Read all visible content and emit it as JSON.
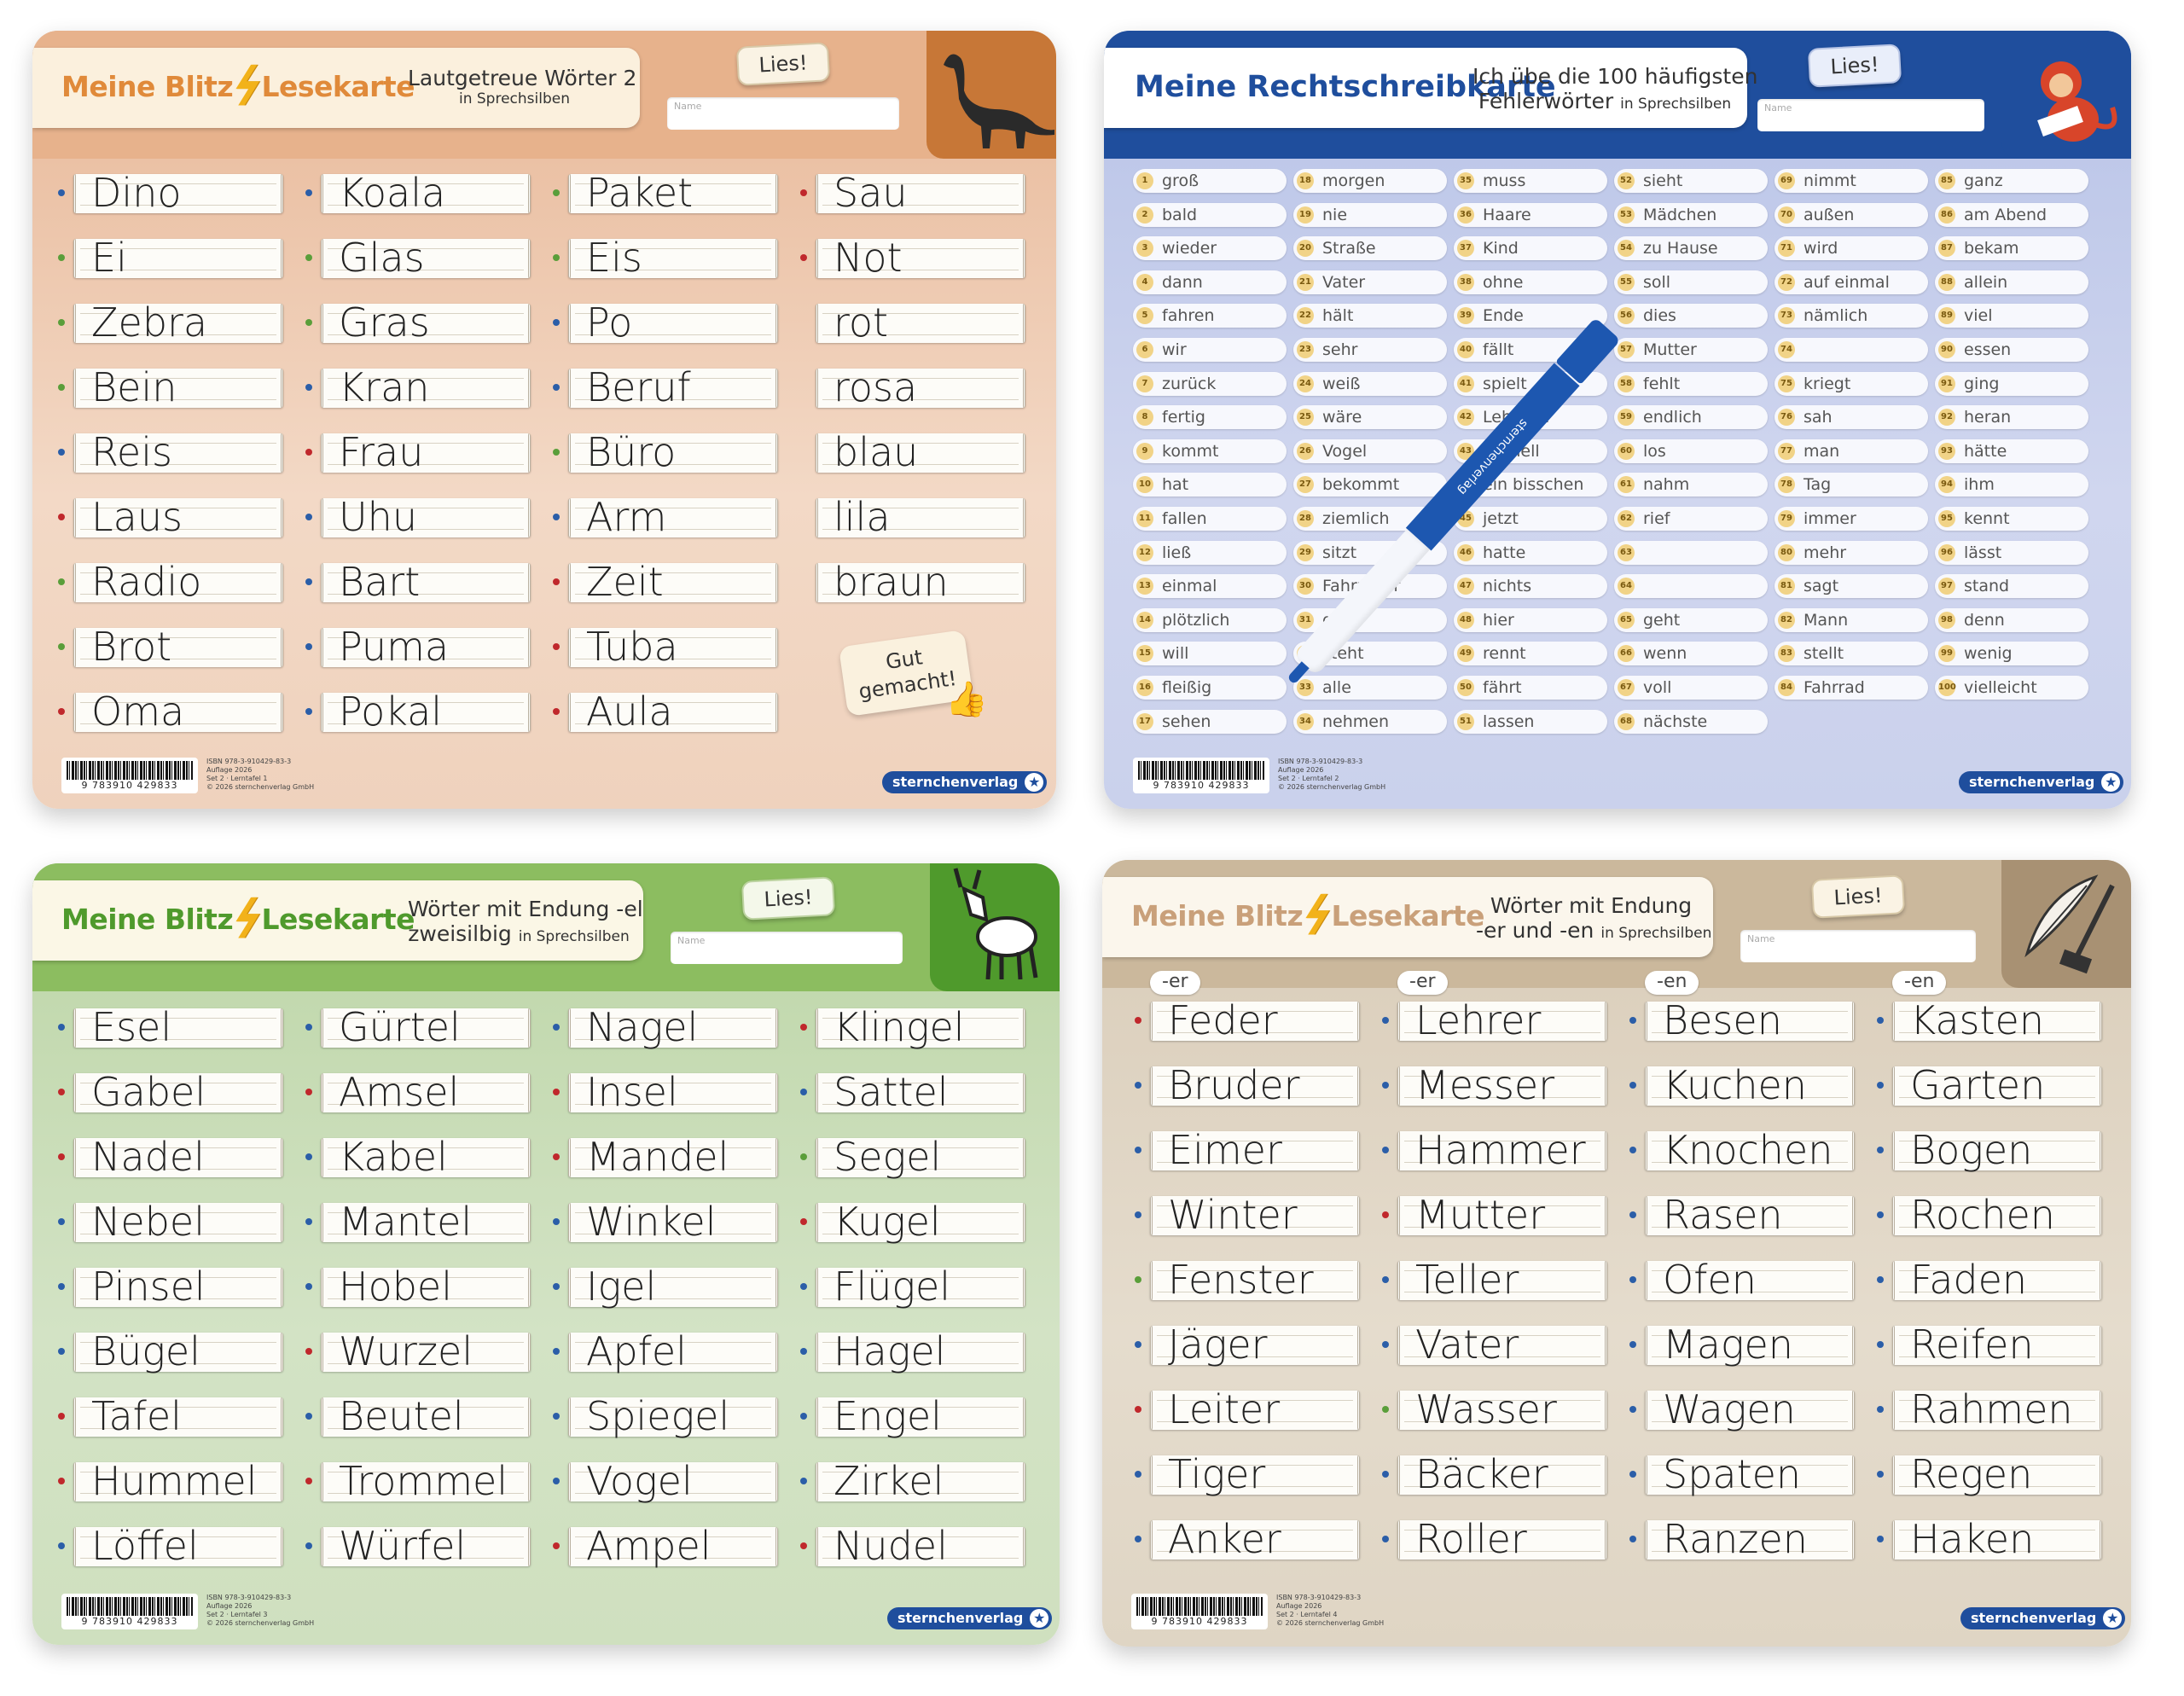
{
  "colors": {
    "orange_bg": "#ecc5ab",
    "orange_head": "#e2a77e",
    "blue_bg": "#c4cce9",
    "blue_head": "#1f4e9d",
    "green_bg": "#c9dcb7",
    "green_head": "#7fb25a",
    "beige_bg": "#ddd2c0",
    "beige_head": "#c7b499",
    "dot_red": "#c0282c",
    "dot_blue": "#2b5ea8",
    "dot_green": "#5a9e3a"
  },
  "card1": {
    "brand_meine": "Meine Blitz",
    "brand_rest": "Lesekarte",
    "subtitle_line1": "Lautgetreue Wörter 2",
    "subtitle_small": "in Sprechsilben",
    "lies": "Lies!",
    "name_label": "Name",
    "icon": "dinosaur-icon",
    "columns": [
      [
        "Dino",
        "Ei",
        "Zebra",
        "Bein",
        "Reis",
        "Laus",
        "Radio",
        "Brot",
        "Oma"
      ],
      [
        "Koala",
        "Glas",
        "Gras",
        "Kran",
        "Frau",
        "Uhu",
        "Bart",
        "Puma",
        "Pokal"
      ],
      [
        "Paket",
        "Eis",
        "Po",
        "Beruf",
        "Büro",
        "Arm",
        "Zeit",
        "Tuba",
        "Aula"
      ],
      [
        "Sau",
        "Not",
        "rot",
        "rosa",
        "blau",
        "lila",
        "braun"
      ]
    ],
    "dots": [
      [
        "blue",
        "green",
        "green",
        "green",
        "blue",
        "red",
        "green",
        "green",
        "red"
      ],
      [
        "blue",
        "green",
        "green",
        "blue",
        "red",
        "blue",
        "blue",
        "blue",
        "blue"
      ],
      [
        "green",
        "green",
        "blue",
        "blue",
        "green",
        "blue",
        "red",
        "red",
        "red"
      ],
      [
        "red",
        "red",
        "none",
        "none",
        "none",
        "none",
        "none"
      ]
    ],
    "gut": "Gut gemacht!",
    "isbn_lines": [
      "ISBN 978-3-910429-83-3",
      "Auflage 2026",
      "Set 2 · Lerntafel 1",
      "© 2026 sternchenverlag GmbH"
    ],
    "barcode_number": "9 783910 429833",
    "logo": "sternchenverlag"
  },
  "card2": {
    "title": "Meine Rechtschreibkarte",
    "subtitle_line1": "Ich übe die 100 häufigsten",
    "subtitle_line2": "Fehlerwörter",
    "subtitle_small": "in Sprechsilben",
    "lies": "Lies!",
    "name_label": "Name",
    "icon": "monkey-icon",
    "columns": [
      [
        "groß",
        "bald",
        "wieder",
        "dann",
        "fahren",
        "wir",
        "zurück",
        "fertig",
        "kommt",
        "hat",
        "fallen",
        "ließ",
        "einmal",
        "plötzlich",
        "will",
        "fleißig",
        "sehen"
      ],
      [
        "morgen",
        "nie",
        "Straße",
        "Vater",
        "hält",
        "sehr",
        "weiß",
        "wäre",
        "Vogel",
        "bekommt",
        "ziemlich",
        "sitzt",
        "Fahrräder",
        "gibt",
        "steht",
        "alle",
        "nehmen"
      ],
      [
        "muss",
        "Haare",
        "Kind",
        "ohne",
        "Ende",
        "fällt",
        "spielt",
        "Lehrerin",
        "schnell",
        "ein bisschen",
        "jetzt",
        "hatte",
        "nichts",
        "hier",
        "rennt",
        "fährt",
        "lassen"
      ],
      [
        "sieht",
        "Mädchen",
        "zu Hause",
        "soll",
        "dies",
        "Mutter",
        "fehlt",
        "endlich",
        "los",
        "nahm",
        "rief",
        "",
        "",
        "geht",
        "wenn",
        "voll",
        "nächste"
      ],
      [
        "nimmt",
        "außen",
        "wird",
        "auf einmal",
        "nämlich",
        "",
        "kriegt",
        "sah",
        "man",
        "Tag",
        "immer",
        "mehr",
        "sagt",
        "Mann",
        "stellt",
        "Fahrrad"
      ],
      [
        "ganz",
        "am Abend",
        "bekam",
        "allein",
        "viel",
        "essen",
        "ging",
        "heran",
        "hätte",
        "ihm",
        "kennt",
        "lässt",
        "stand",
        "denn",
        "wenig",
        "vielleicht"
      ]
    ],
    "numbers": [
      [
        "1",
        "2",
        "3",
        "4",
        "5",
        "6",
        "7",
        "8",
        "9",
        "10",
        "11",
        "12",
        "13",
        "14",
        "15",
        "16",
        "17"
      ],
      [
        "18",
        "19",
        "20",
        "21",
        "22",
        "23",
        "24",
        "25",
        "26",
        "27",
        "28",
        "29",
        "30",
        "31",
        "32",
        "33",
        "34"
      ],
      [
        "35",
        "36",
        "37",
        "38",
        "39",
        "40",
        "41",
        "42",
        "43",
        "44",
        "45",
        "46",
        "47",
        "48",
        "49",
        "50",
        "51"
      ],
      [
        "52",
        "53",
        "54",
        "55",
        "56",
        "57",
        "58",
        "59",
        "60",
        "61",
        "62",
        "63",
        "64",
        "65",
        "66",
        "67",
        "68"
      ],
      [
        "69",
        "70",
        "71",
        "72",
        "73",
        "74",
        "75",
        "76",
        "77",
        "78",
        "79",
        "80",
        "81",
        "82",
        "83",
        "84"
      ],
      [
        "85",
        "86",
        "87",
        "88",
        "89",
        "90",
        "91",
        "92",
        "93",
        "94",
        "95",
        "96",
        "97",
        "98",
        "99",
        "100"
      ]
    ],
    "pen_label": "sternchenverlag",
    "isbn_lines": [
      "ISBN 978-3-910429-83-3",
      "Auflage 2026",
      "Set 2 · Lerntafel 2",
      "© 2026 sternchenverlag GmbH"
    ],
    "barcode_number": "9 783910 429833",
    "logo": "sternchenverlag"
  },
  "card3": {
    "brand_meine": "Meine Blitz",
    "brand_rest": "Lesekarte",
    "subtitle_line1": "Wörter mit Endung -el",
    "subtitle_line2": "zweisilbig",
    "subtitle_small": "in Sprechsilben",
    "lies": "Lies!",
    "name_label": "Name",
    "icon": "donkey-icon",
    "columns": [
      [
        "Esel",
        "Gabel",
        "Nadel",
        "Nebel",
        "Pinsel",
        "Bügel",
        "Tafel",
        "Hummel",
        "Löffel"
      ],
      [
        "Gürtel",
        "Amsel",
        "Kabel",
        "Mantel",
        "Hobel",
        "Wurzel",
        "Beutel",
        "Trommel",
        "Würfel"
      ],
      [
        "Nagel",
        "Insel",
        "Mandel",
        "Winkel",
        "Igel",
        "Apfel",
        "Spiegel",
        "Vogel",
        "Ampel"
      ],
      [
        "Klingel",
        "Sattel",
        "Segel",
        "Kugel",
        "Flügel",
        "Hagel",
        "Engel",
        "Zirkel",
        "Nudel"
      ]
    ],
    "dots": [
      [
        "blue",
        "red",
        "red",
        "blue",
        "blue",
        "blue",
        "red",
        "red",
        "blue"
      ],
      [
        "blue",
        "red",
        "blue",
        "blue",
        "blue",
        "red",
        "blue",
        "red",
        "blue"
      ],
      [
        "blue",
        "red",
        "red",
        "blue",
        "blue",
        "blue",
        "blue",
        "blue",
        "red"
      ],
      [
        "red",
        "blue",
        "green",
        "red",
        "blue",
        "blue",
        "blue",
        "blue",
        "red"
      ]
    ],
    "isbn_lines": [
      "ISBN 978-3-910429-83-3",
      "Auflage 2026",
      "Set 2 · Lerntafel 3",
      "© 2026 sternchenverlag GmbH"
    ],
    "barcode_number": "9 783910 429833",
    "logo": "sternchenverlag"
  },
  "card4": {
    "brand_meine": "Meine Blitz",
    "brand_rest": "Lesekarte",
    "subtitle_line1": "Wörter mit Endung",
    "subtitle_line2": "-er und -en",
    "subtitle_small": "in Sprechsilben",
    "lies": "Lies!",
    "name_label": "Name",
    "icon": "feather-hammer-icon",
    "suffixes": [
      "-er",
      "-er",
      "-en",
      "-en"
    ],
    "columns": [
      [
        "Feder",
        "Bruder",
        "Eimer",
        "Winter",
        "Fenster",
        "Jäger",
        "Leiter",
        "Tiger",
        "Anker"
      ],
      [
        "Lehrer",
        "Messer",
        "Hammer",
        "Mutter",
        "Teller",
        "Vater",
        "Wasser",
        "Bäcker",
        "Roller"
      ],
      [
        "Besen",
        "Kuchen",
        "Knochen",
        "Rasen",
        "Ofen",
        "Magen",
        "Wagen",
        "Spaten",
        "Ranzen"
      ],
      [
        "Kasten",
        "Garten",
        "Bogen",
        "Rochen",
        "Faden",
        "Reifen",
        "Rahmen",
        "Regen",
        "Haken"
      ]
    ],
    "dots": [
      [
        "red",
        "blue",
        "blue",
        "blue",
        "green",
        "blue",
        "red",
        "blue",
        "blue"
      ],
      [
        "blue",
        "blue",
        "blue",
        "red",
        "blue",
        "blue",
        "green",
        "blue",
        "blue"
      ],
      [
        "blue",
        "blue",
        "blue",
        "blue",
        "blue",
        "blue",
        "blue",
        "blue",
        "blue"
      ],
      [
        "blue",
        "blue",
        "blue",
        "blue",
        "blue",
        "blue",
        "blue",
        "blue",
        "blue"
      ]
    ],
    "isbn_lines": [
      "ISBN 978-3-910429-83-3",
      "Auflage 2026",
      "Set 2 · Lerntafel 4",
      "© 2026 sternchenverlag GmbH"
    ],
    "barcode_number": "9 783910 429833",
    "logo": "sternchenverlag"
  }
}
